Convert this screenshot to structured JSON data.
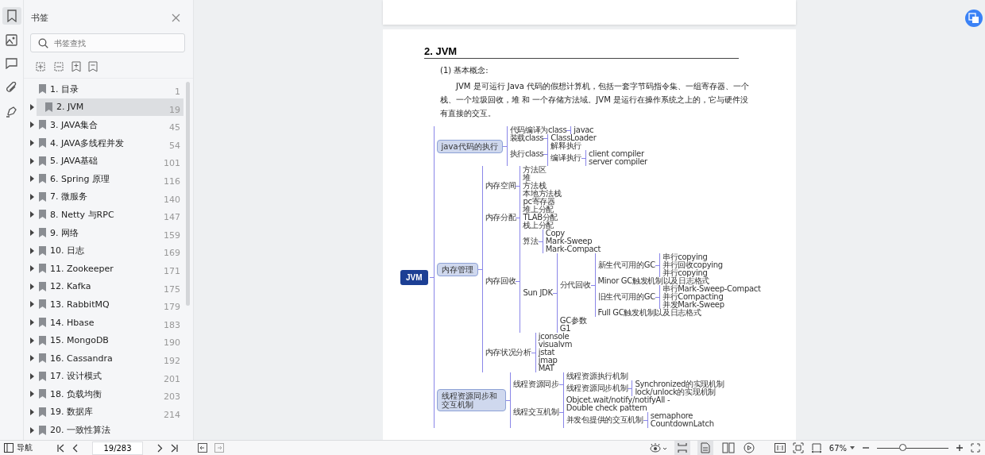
{
  "rail": [
    {
      "kind": "bookmark",
      "selected": true
    },
    {
      "kind": "image",
      "selected": false
    },
    {
      "kind": "comment",
      "selected": false
    },
    {
      "kind": "attachment",
      "selected": false
    },
    {
      "kind": "sign",
      "selected": false
    }
  ],
  "panel": {
    "title": "书签",
    "search_placeholder": "书签查找"
  },
  "bookmarks": [
    {
      "label": "1. 目录",
      "page": "1",
      "expandable": false,
      "selected": false
    },
    {
      "label": "2. JVM",
      "page": "19",
      "expandable": true,
      "selected": true
    },
    {
      "label": "3. JAVA集合",
      "page": "45",
      "expandable": true,
      "selected": false
    },
    {
      "label": "4. JAVA多线程并发",
      "page": "54",
      "expandable": true,
      "selected": false
    },
    {
      "label": "5. JAVA基础",
      "page": "101",
      "expandable": true,
      "selected": false
    },
    {
      "label": "6. Spring 原理",
      "page": "116",
      "expandable": true,
      "selected": false
    },
    {
      "label": "7.   微服务",
      "page": "140",
      "expandable": true,
      "selected": false
    },
    {
      "label": "8. Netty 与RPC",
      "page": "147",
      "expandable": true,
      "selected": false
    },
    {
      "label": "9. 网络",
      "page": "159",
      "expandable": true,
      "selected": false
    },
    {
      "label": "10. 日志",
      "page": "169",
      "expandable": true,
      "selected": false
    },
    {
      "label": "11. Zookeeper",
      "page": "171",
      "expandable": true,
      "selected": false
    },
    {
      "label": "12. Kafka",
      "page": "175",
      "expandable": true,
      "selected": false
    },
    {
      "label": "13. RabbitMQ",
      "page": "179",
      "expandable": true,
      "selected": false
    },
    {
      "label": "14. Hbase",
      "page": "183",
      "expandable": true,
      "selected": false
    },
    {
      "label": "15. MongoDB",
      "page": "190",
      "expandable": true,
      "selected": false
    },
    {
      "label": "16. Cassandra",
      "page": "192",
      "expandable": true,
      "selected": false
    },
    {
      "label": "17. 设计模式",
      "page": "201",
      "expandable": true,
      "selected": false
    },
    {
      "label": "18. 负载均衡",
      "page": "203",
      "expandable": true,
      "selected": false
    },
    {
      "label": "19. 数据库",
      "page": "214",
      "expandable": true,
      "selected": false
    },
    {
      "label": "20. 一致性算法",
      "expandable": true,
      "selected": false
    }
  ],
  "document": {
    "heading": "2. JVM",
    "subheading": "(1) 基本概念:",
    "paragraph": "JVM 是可运行 Java 代码的假想计算机，包括一套字节码指令集、一组寄存器、一个栈、一个垃圾回收，堆 和 一个存储方法域。JVM 是运行在操作系统之上的，它与硬件没有直接的交互。",
    "mindmap": {
      "label": "JVM",
      "kind": "root",
      "children": [
        {
          "label": "java代码的执行",
          "kind": "bubble",
          "children": [
            {
              "label": "代码编译为class",
              "kind": "text",
              "children": [
                {
                  "label": "javac",
                  "kind": "text"
                }
              ]
            },
            {
              "label": "装载class",
              "kind": "text",
              "children": [
                {
                  "label": "ClassLoader",
                  "kind": "text"
                }
              ]
            },
            {
              "label": "执行class",
              "kind": "text",
              "children": [
                {
                  "label": "解释执行",
                  "kind": "text"
                },
                {
                  "label": "编译执行",
                  "kind": "text",
                  "children": [
                    {
                      "label": "client compiler",
                      "kind": "text"
                    },
                    {
                      "label": "server compiler",
                      "kind": "text"
                    }
                  ]
                }
              ]
            }
          ]
        },
        {
          "label": "内存管理",
          "kind": "bubble",
          "children": [
            {
              "label": "内存空间",
              "kind": "text",
              "children": [
                {
                  "label": "方法区",
                  "kind": "text"
                },
                {
                  "label": "堆",
                  "kind": "text"
                },
                {
                  "label": "方法栈",
                  "kind": "text"
                },
                {
                  "label": "本地方法栈",
                  "kind": "text"
                },
                {
                  "label": "pc寄存器",
                  "kind": "text"
                }
              ]
            },
            {
              "label": "内存分配",
              "kind": "text",
              "children": [
                {
                  "label": "堆上分配",
                  "kind": "text"
                },
                {
                  "label": "TLAB分配",
                  "kind": "text"
                },
                {
                  "label": "栈上分配",
                  "kind": "text"
                }
              ]
            },
            {
              "label": "内存回收",
              "kind": "text",
              "children": [
                {
                  "label": "算法",
                  "kind": "text",
                  "children": [
                    {
                      "label": "Copy",
                      "kind": "text"
                    },
                    {
                      "label": "Mark-Sweep",
                      "kind": "text"
                    },
                    {
                      "label": "Mark-Compact",
                      "kind": "text"
                    }
                  ]
                },
                {
                  "label": "Sun JDK",
                  "kind": "text",
                  "children": [
                    {
                      "label": "分代回收",
                      "kind": "text",
                      "children": [
                        {
                          "label": "新生代可用的GC",
                          "kind": "text",
                          "children": [
                            {
                              "label": "串行copying",
                              "kind": "text"
                            },
                            {
                              "label": "并行回收copying",
                              "kind": "text"
                            },
                            {
                              "label": "并行copying",
                              "kind": "text"
                            }
                          ]
                        },
                        {
                          "label": "Minor GC触发机制以及日志格式",
                          "kind": "text"
                        },
                        {
                          "label": "旧生代可用的GC",
                          "kind": "text",
                          "children": [
                            {
                              "label": "串行Mark-Sweep-Compact",
                              "kind": "text"
                            },
                            {
                              "label": "并行Compacting",
                              "kind": "text"
                            },
                            {
                              "label": "并发Mark-Sweep",
                              "kind": "text"
                            }
                          ]
                        },
                        {
                          "label": "Full GC触发机制以及日志格式",
                          "kind": "text"
                        }
                      ]
                    },
                    {
                      "label": "GC参数",
                      "kind": "text"
                    },
                    {
                      "label": "G1",
                      "kind": "text"
                    }
                  ]
                }
              ]
            },
            {
              "label": "内存状况分析",
              "kind": "text",
              "children": [
                {
                  "label": "jconsole",
                  "kind": "text"
                },
                {
                  "label": "visualvm",
                  "kind": "text"
                },
                {
                  "label": "jstat",
                  "kind": "text"
                },
                {
                  "label": "jmap",
                  "kind": "text"
                },
                {
                  "label": "MAT",
                  "kind": "text"
                }
              ]
            }
          ]
        },
        {
          "label": "线程资源同步和交互机制",
          "kind": "bubble",
          "children": [
            {
              "label": "线程资源同步",
              "kind": "text",
              "children": [
                {
                  "label": "线程资源执行机制",
                  "kind": "text"
                },
                {
                  "label": "线程资源同步机制",
                  "kind": "text",
                  "children": [
                    {
                      "label": "Synchronized的实现机制",
                      "kind": "text"
                    },
                    {
                      "label": "lock/unlock的实现机制",
                      "kind": "text"
                    }
                  ]
                }
              ]
            },
            {
              "label": "线程交互机制",
              "kind": "text",
              "children": [
                {
                  "label": "Objcet.wait/notify/notifyAll -\nDouble check pattern",
                  "kind": "text"
                },
                {
                  "label": "并发包提供的交互机制",
                  "kind": "text",
                  "children": [
                    {
                      "label": "semaphore",
                      "kind": "text"
                    },
                    {
                      "label": "CountdownLatch",
                      "kind": "text"
                    }
                  ]
                }
              ]
            }
          ]
        }
      ]
    }
  },
  "status_bar": {
    "nav_label": "导航",
    "page_field": "19/283",
    "views": [
      {
        "kind": "scroll",
        "selected": true
      },
      {
        "kind": "single",
        "selected": true
      },
      {
        "kind": "double",
        "selected": false
      }
    ],
    "zoom": "67%",
    "zoom_slider": {
      "level": 0.37
    }
  }
}
